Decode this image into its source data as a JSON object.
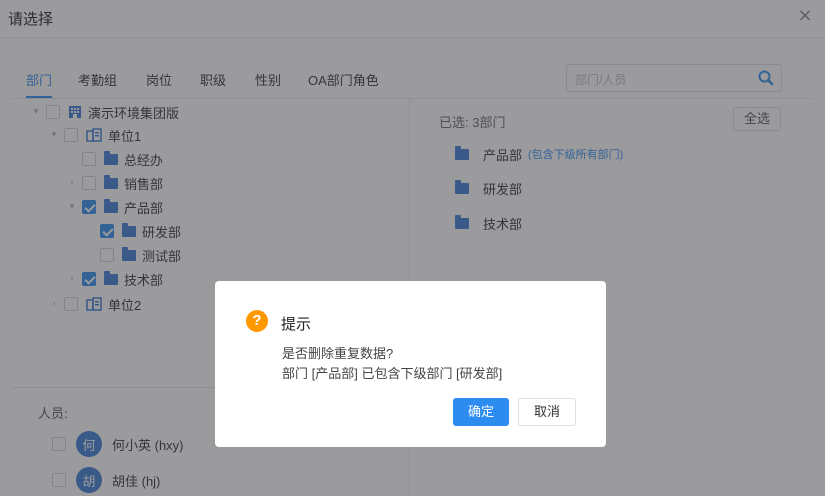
{
  "dialog": {
    "title": "请选择",
    "close_glyph": "×"
  },
  "tabs": [
    {
      "label": "部门",
      "active": true
    },
    {
      "label": "考勤组"
    },
    {
      "label": "岗位"
    },
    {
      "label": "职级"
    },
    {
      "label": "性别"
    },
    {
      "label": "OA部门角色"
    }
  ],
  "search": {
    "placeholder": "部门/人员",
    "icon": "search-icon"
  },
  "tree": [
    {
      "label": "演示环境集团版",
      "icon": "building-icon",
      "arrow": "▾",
      "checked": false
    },
    {
      "label": "单位1",
      "icon": "company-icon",
      "arrow": "▾",
      "checked": false
    },
    {
      "label": "总经办",
      "icon": "folder-icon",
      "arrow": "",
      "checked": false
    },
    {
      "label": "销售部",
      "icon": "folder-icon",
      "arrow": "›",
      "checked": false
    },
    {
      "label": "产品部",
      "icon": "folder-icon",
      "arrow": "▾",
      "checked": true
    },
    {
      "label": "研发部",
      "icon": "folder-icon",
      "arrow": "",
      "checked": true
    },
    {
      "label": "测试部",
      "icon": "folder-icon",
      "arrow": "",
      "checked": false
    },
    {
      "label": "技术部",
      "icon": "folder-icon",
      "arrow": "›",
      "checked": true
    },
    {
      "label": "单位2",
      "icon": "company-icon",
      "arrow": "›",
      "checked": false
    }
  ],
  "people": {
    "title": "人员:",
    "items": [
      {
        "avatar": "何",
        "name": "何小英 (hxy)"
      },
      {
        "avatar": "胡",
        "name": "胡佳 (hj)"
      }
    ]
  },
  "selected": {
    "count_label": "已选: 3部门",
    "select_all_label": "全选",
    "items": [
      {
        "label": "产品部",
        "note": "(包含下级所有部门)"
      },
      {
        "label": "研发部",
        "note": ""
      },
      {
        "label": "技术部",
        "note": ""
      }
    ]
  },
  "modal": {
    "icon_glyph": "?",
    "title": "提示",
    "line1": "是否删除重复数据?",
    "line2": "部门 [产品部] 已包含下级部门 [研发部]",
    "ok_label": "确定",
    "cancel_label": "取消"
  },
  "colors": {
    "accent": "#2d8cf0",
    "warning": "#ff9900",
    "folder": "#3a7bd5"
  }
}
